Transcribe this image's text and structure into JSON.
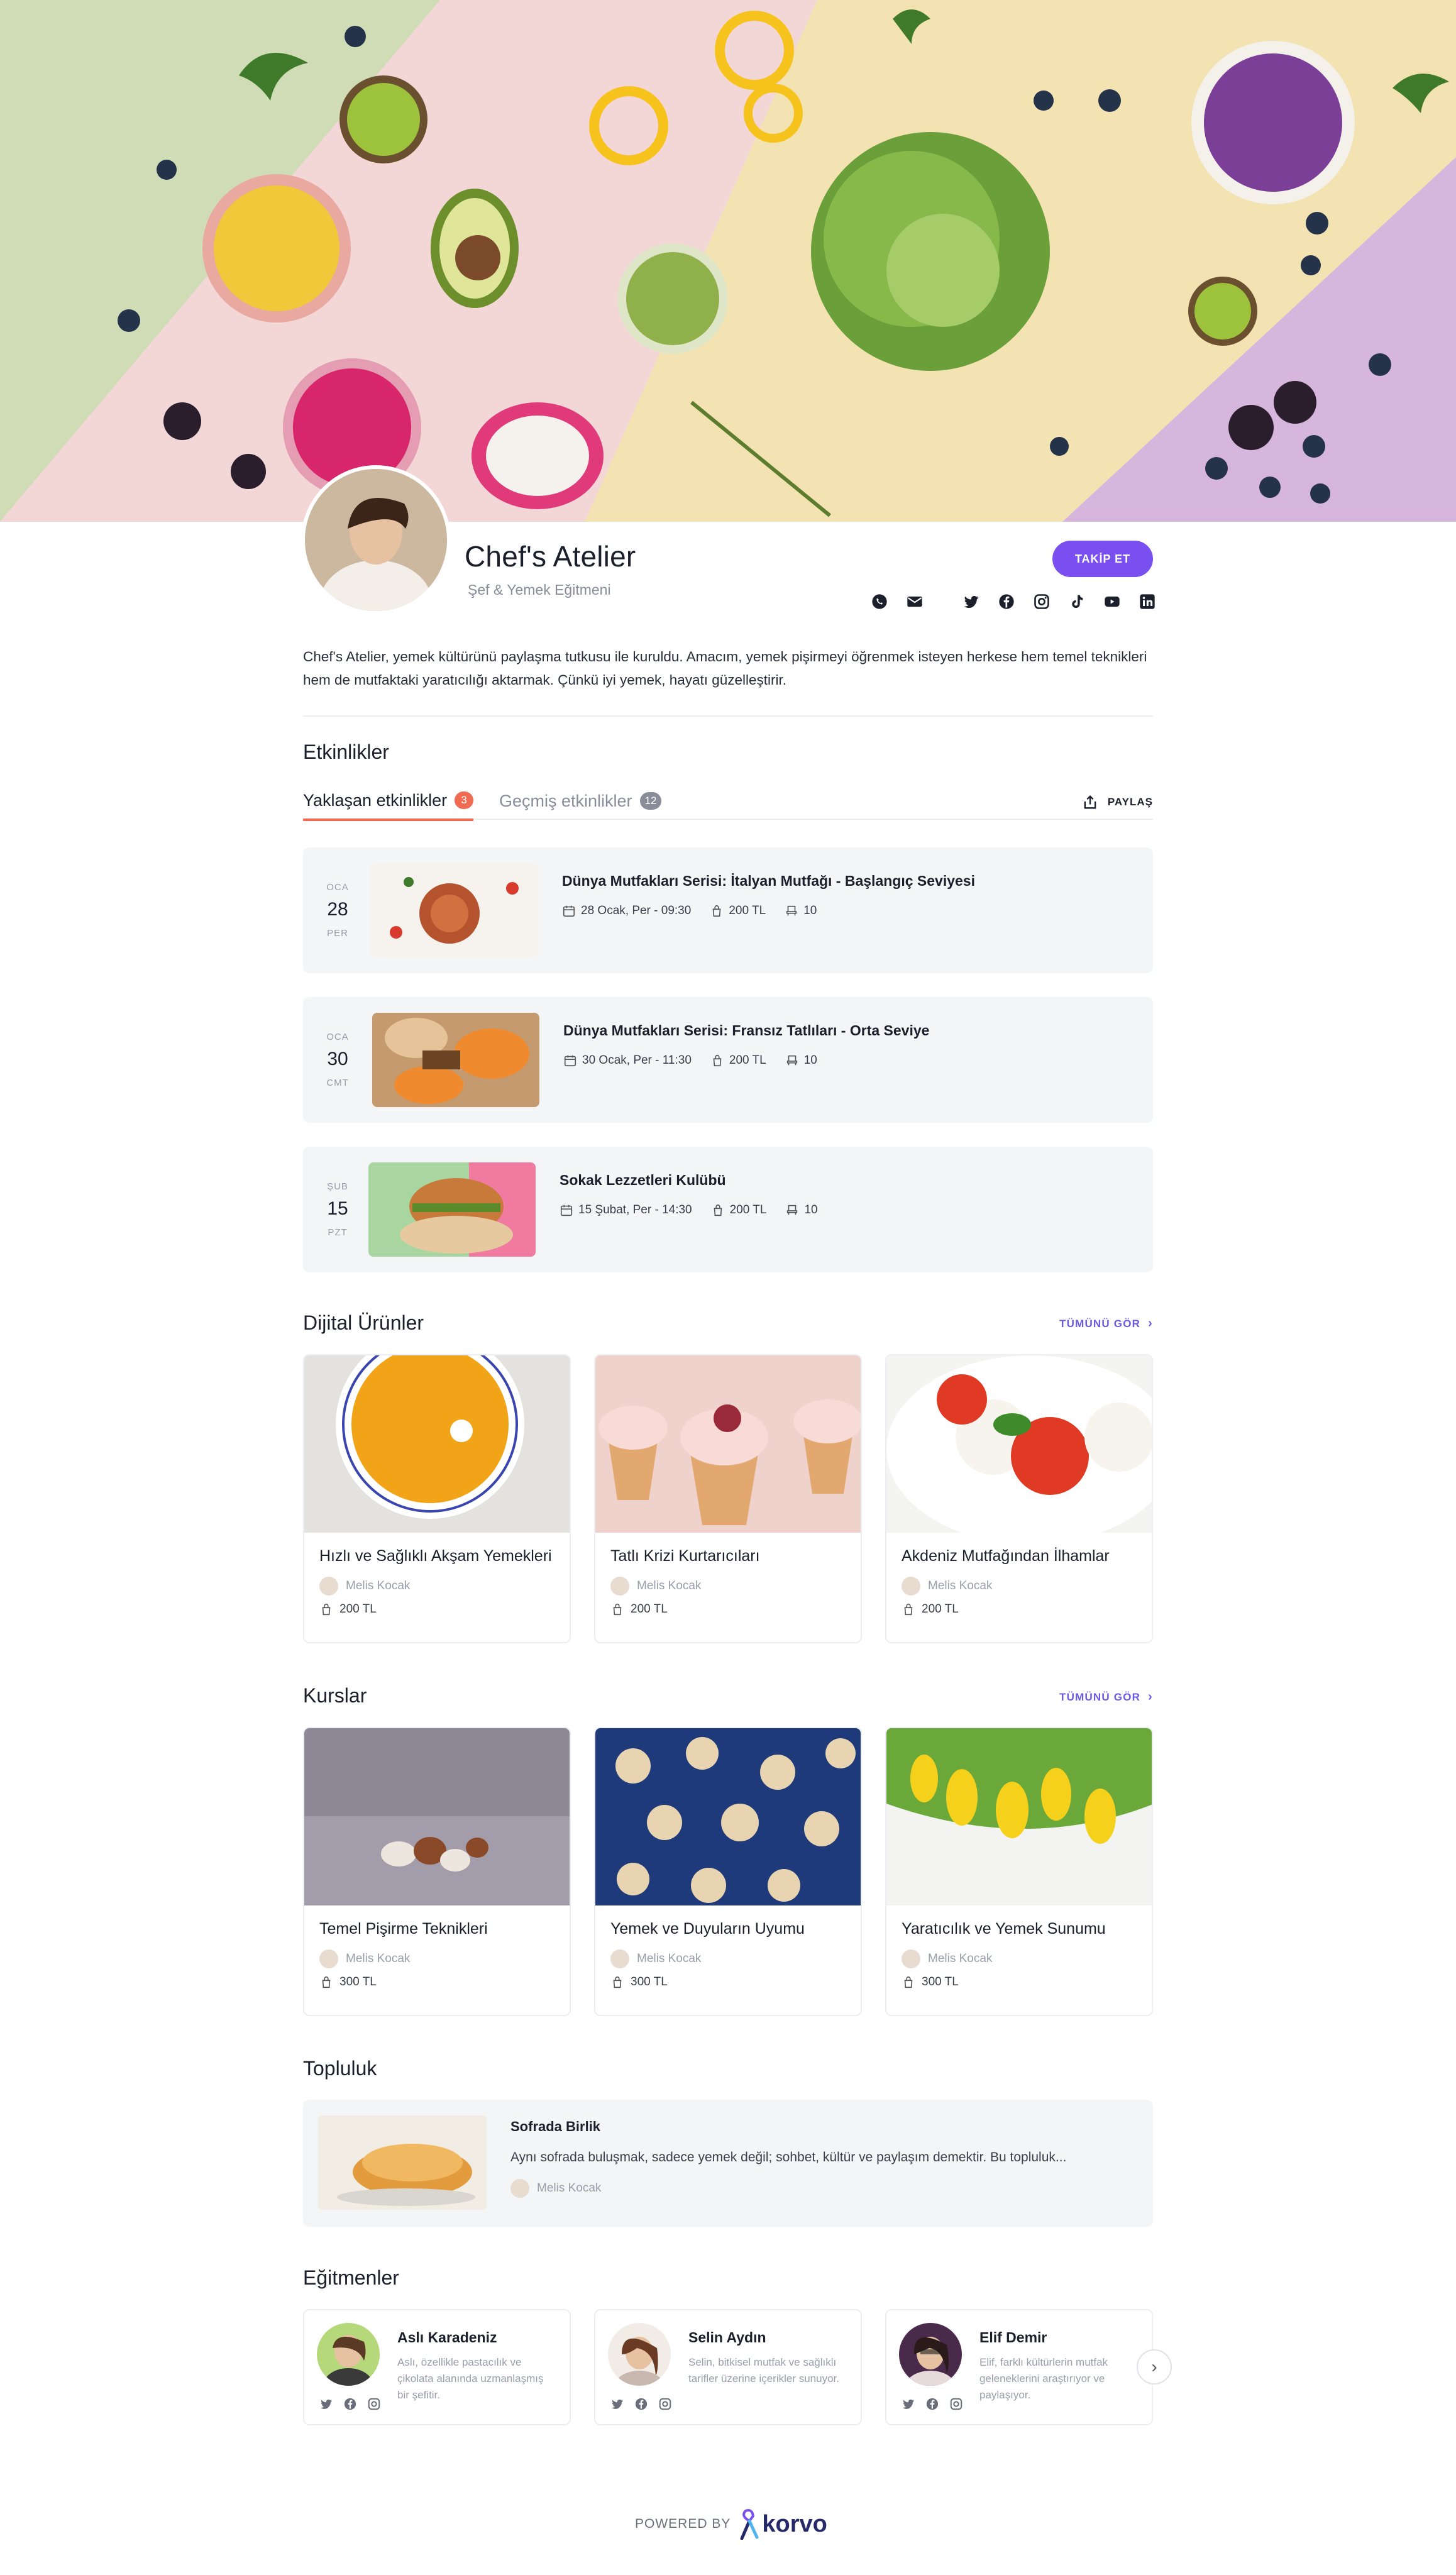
{
  "profile": {
    "name": "Chef's Atelier",
    "subtitle": "Şef & Yemek Eğitmeni",
    "follow_label": "TAKİP ET",
    "about": "Chef's Atelier, yemek kültürünü paylaşma tutkusu ile kuruldu. Amacım, yemek pişirmeyi öğrenmek isteyen herkese hem temel teknikleri hem de mutfaktaki yaratıcılığı aktarmak. Çünkü iyi yemek, hayatı güzelleştirir.",
    "social_icons": [
      "whatsapp-icon",
      "mail-icon",
      "twitter-icon",
      "facebook-icon",
      "instagram-icon",
      "tiktok-icon",
      "youtube-icon",
      "linkedin-icon"
    ]
  },
  "events": {
    "title": "Etkinlikler",
    "tabs": [
      {
        "label": "Yaklaşan etkinlikler",
        "count": "3"
      },
      {
        "label": "Geçmiş etkinlikler",
        "count": "12"
      }
    ],
    "share_label": "PAYLAŞ",
    "items": [
      {
        "month": "OCA",
        "day": "28",
        "weekday": "PER",
        "title": "Dünya Mutfakları Serisi: İtalyan Mutfağı - Başlangıç Seviyesi",
        "datetime": "28 Ocak, Per - 09:30",
        "price": "200 TL",
        "seats": "10"
      },
      {
        "month": "OCA",
        "day": "30",
        "weekday": "CMT",
        "title": "Dünya Mutfakları Serisi: Fransız Tatlıları - Orta Seviye",
        "datetime": "30 Ocak, Per - 11:30",
        "price": "200 TL",
        "seats": "10"
      },
      {
        "month": "ŞUB",
        "day": "15",
        "weekday": "PZT",
        "title": "Sokak Lezzetleri Kulübü",
        "datetime": "15 Şubat, Per - 14:30",
        "price": "200 TL",
        "seats": "10"
      }
    ]
  },
  "digital": {
    "title": "Dijital Ürünler",
    "see_all": "TÜMÜNÜ GÖR",
    "items": [
      {
        "title": "Hızlı ve Sağlıklı Akşam Yemekleri",
        "author": "Melis Kocak",
        "price": "200 TL"
      },
      {
        "title": "Tatlı Krizi Kurtarıcıları",
        "author": "Melis Kocak",
        "price": "200 TL"
      },
      {
        "title": "Akdeniz Mutfağından İlhamlar",
        "author": "Melis Kocak",
        "price": "200 TL"
      }
    ]
  },
  "courses": {
    "title": "Kurslar",
    "see_all": "TÜMÜNÜ GÖR",
    "items": [
      {
        "title": "Temel Pişirme Teknikleri",
        "author": "Melis Kocak",
        "price": "300 TL"
      },
      {
        "title": "Yemek ve Duyuların Uyumu",
        "author": "Melis Kocak",
        "price": "300 TL"
      },
      {
        "title": "Yaratıcılık ve Yemek Sunumu",
        "author": "Melis Kocak",
        "price": "300 TL"
      }
    ]
  },
  "community": {
    "title": "Topluluk",
    "item": {
      "title": "Sofrada Birlik",
      "desc": "Aynı sofrada buluşmak, sadece yemek değil; sohbet, kültür ve paylaşım demektir. Bu topluluk...",
      "author": "Melis Kocak"
    }
  },
  "instructors": {
    "title": "Eğitmenler",
    "items": [
      {
        "name": "Aslı Karadeniz",
        "desc": "Aslı, özellikle pastacılık ve çikolata alanında uzmanlaşmış bir şefitir."
      },
      {
        "name": "Selin Aydın",
        "desc": "Selin, bitkisel mutfak ve sağlıklı tarifler üzerine içerikler sunuyor."
      },
      {
        "name": "Elif Demir",
        "desc": "Elif, farklı kültürlerin mutfak geleneklerini araştırıyor ve paylaşıyor."
      }
    ]
  },
  "footer": {
    "powered_by": "POWERED BY",
    "brand": "korvo"
  },
  "colors": {
    "accent": "#7a4ff0",
    "tab_active": "#f06b52",
    "link": "#6a5be0"
  }
}
